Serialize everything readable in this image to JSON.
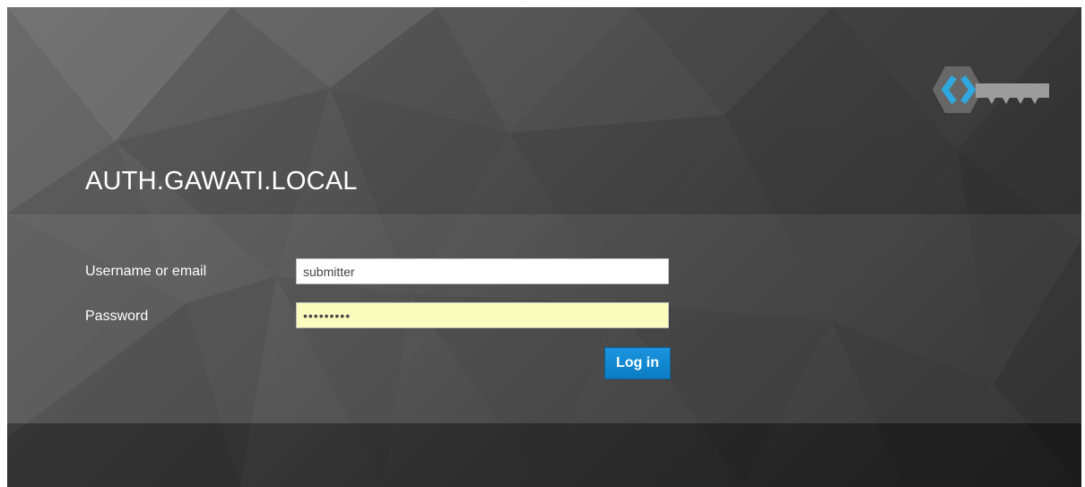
{
  "login": {
    "realm_title": "AUTH.GAWATI.LOCAL",
    "username_label": "Username or email",
    "username_value": "submitter",
    "password_label": "Password",
    "password_value": "•••••••••",
    "login_button_label": "Log in"
  },
  "icons": {
    "logo": "keycloak-logo-icon"
  },
  "colors": {
    "button_blue": "#0a7cc4",
    "password_autofill_bg": "#fafcbe",
    "logo_cyan": "#2fa8df"
  }
}
